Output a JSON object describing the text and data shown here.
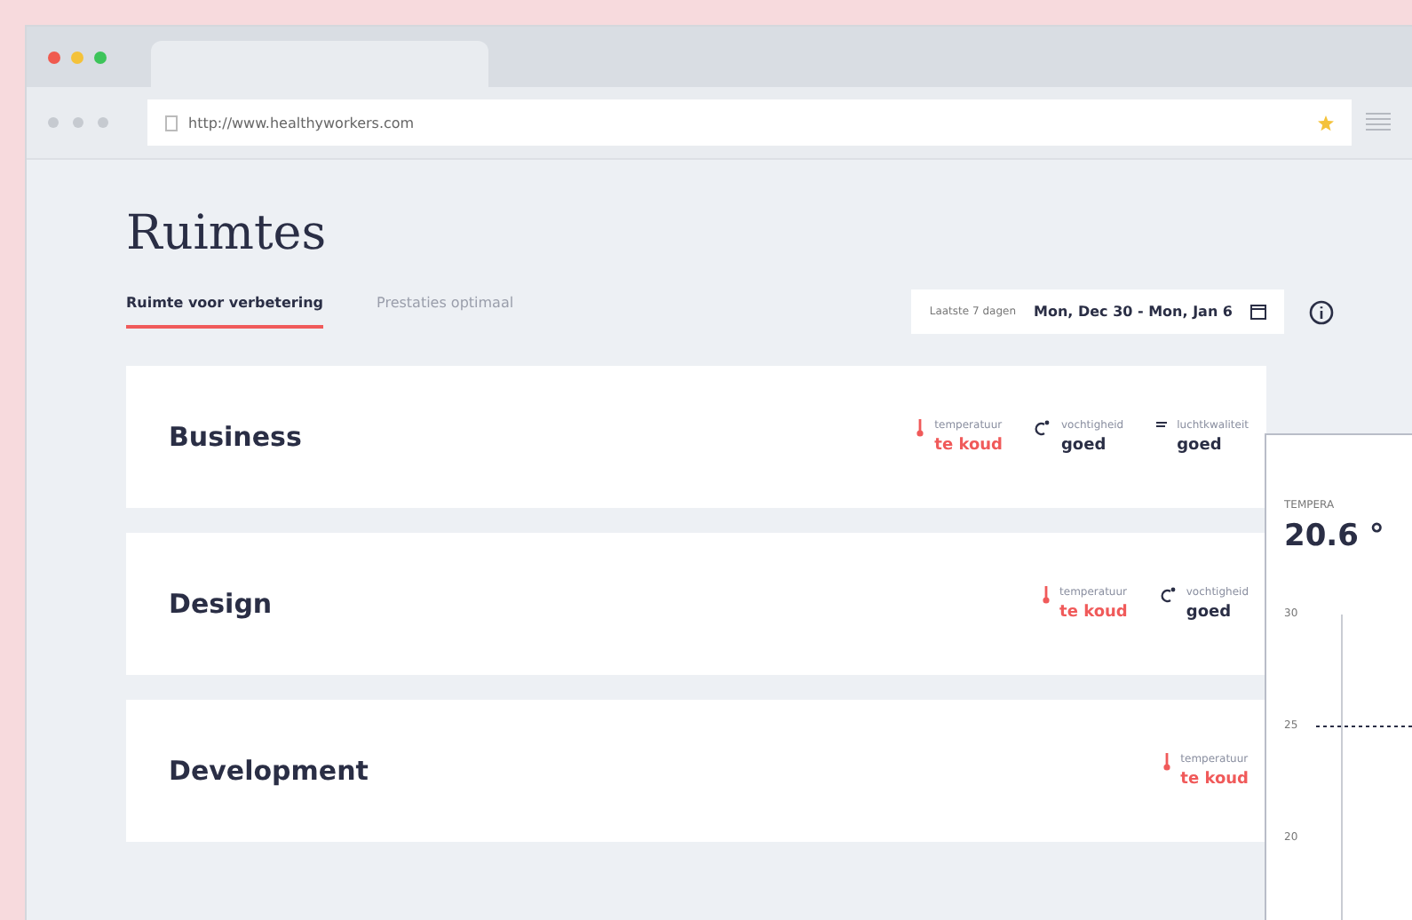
{
  "browser": {
    "url": "http://www.healthyworkers.com"
  },
  "page": {
    "title": "Ruimtes"
  },
  "tabs": [
    {
      "label": "Ruimte voor verbetering",
      "selected": true
    },
    {
      "label": "Prestaties optimaal",
      "selected": false
    }
  ],
  "date_filter": {
    "period": "Laatste 7 dagen",
    "range": "Mon, Dec 30 - Mon, Jan 6"
  },
  "rooms": [
    {
      "name": "Business",
      "metrics": [
        {
          "kind": "temperature",
          "label": "temperatuur",
          "value": "te koud",
          "alert": true
        },
        {
          "kind": "humidity",
          "label": "vochtigheid",
          "value": "goed",
          "alert": false
        },
        {
          "kind": "air",
          "label": "luchtkwaliteit",
          "value": "goed",
          "alert": false
        }
      ]
    },
    {
      "name": "Design",
      "metrics": [
        {
          "kind": "temperature",
          "label": "temperatuur",
          "value": "te koud",
          "alert": true
        },
        {
          "kind": "humidity",
          "label": "vochtigheid",
          "value": "goed",
          "alert": false
        }
      ]
    },
    {
      "name": "Development",
      "metrics": [
        {
          "kind": "temperature",
          "label": "temperatuur",
          "value": "te koud",
          "alert": true
        }
      ]
    }
  ],
  "detail_panel": {
    "title": "TEMPERA",
    "reading": "20.6 °",
    "axis_labels": [
      "30",
      "25",
      "20"
    ]
  }
}
